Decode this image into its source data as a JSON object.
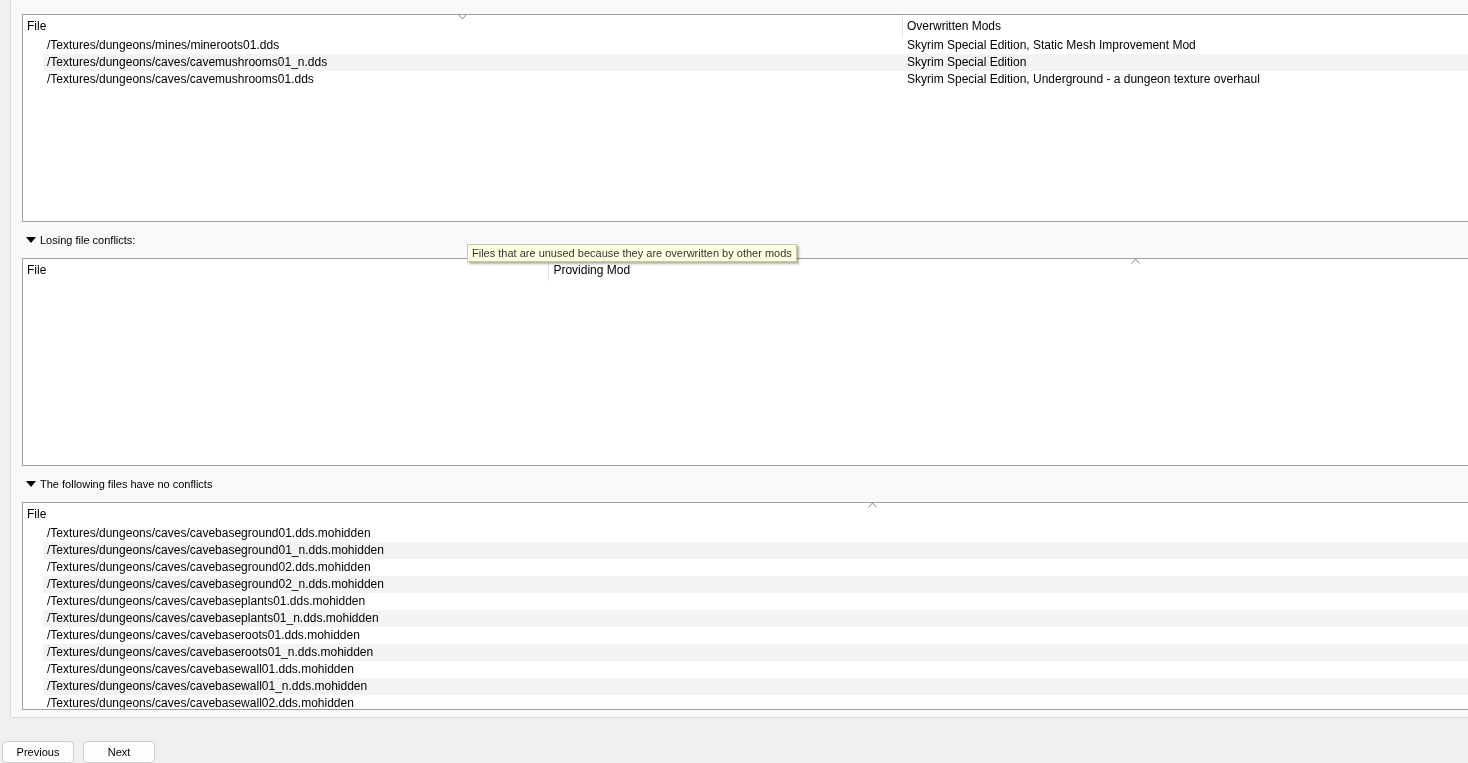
{
  "winning_table": {
    "columns": [
      {
        "label": "File",
        "sorted": true,
        "descending": true
      },
      {
        "label": "Overwritten Mods",
        "sorted": false
      }
    ],
    "rows": [
      [
        "/Textures/dungeons/mines/mineroots01.dds",
        "Skyrim Special Edition, Static Mesh Improvement Mod"
      ],
      [
        "/Textures/dungeons/caves/cavemushrooms01_n.dds",
        "Skyrim Special Edition"
      ],
      [
        "/Textures/dungeons/caves/cavemushrooms01.dds",
        "Skyrim Special Edition, Underground - a dungeon texture overhaul"
      ]
    ]
  },
  "sections": [
    {
      "title": "Losing file conflicts:",
      "expanded": true,
      "tooltip": "Files that are unused because they are overwritten by other mods",
      "table": {
        "columns": [
          {
            "label": "File",
            "sorted": false
          },
          {
            "label": "Providing Mod",
            "sorted": true,
            "descending": false
          }
        ]
      }
    },
    {
      "title": "The following files have no conflicts",
      "expanded": true,
      "table": {
        "columns": [
          {
            "label": "File",
            "sorted": true,
            "descending": false
          }
        ],
        "rows": [
          [
            "/Textures/dungeons/caves/cavebaseground01.dds.mohidden"
          ],
          [
            "/Textures/dungeons/caves/cavebaseground01_n.dds.mohidden"
          ],
          [
            "/Textures/dungeons/caves/cavebaseground02.dds.mohidden"
          ],
          [
            "/Textures/dungeons/caves/cavebaseground02_n.dds.mohidden"
          ],
          [
            "/Textures/dungeons/caves/cavebaseplants01.dds.mohidden"
          ],
          [
            "/Textures/dungeons/caves/cavebaseplants01_n.dds.mohidden"
          ],
          [
            "/Textures/dungeons/caves/cavebaseroots01.dds.mohidden"
          ],
          [
            "/Textures/dungeons/caves/cavebaseroots01_n.dds.mohidden"
          ],
          [
            "/Textures/dungeons/caves/cavebasewall01.dds.mohidden"
          ],
          [
            "/Textures/dungeons/caves/cavebasewall01_n.dds.mohidden"
          ],
          [
            "/Textures/dungeons/caves/cavebasewall02.dds.mohidden"
          ]
        ]
      }
    }
  ],
  "buttons": [
    "Previous",
    "Next"
  ]
}
